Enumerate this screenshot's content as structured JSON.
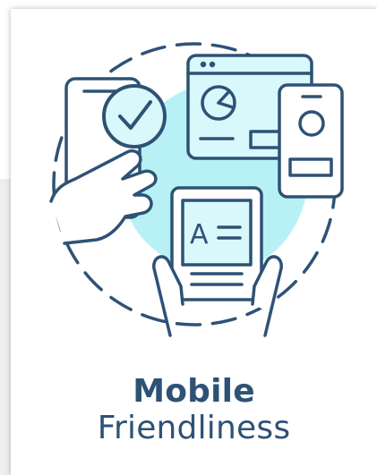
{
  "card": {
    "title": "Mobile",
    "subtitle": "Friendliness"
  },
  "screen_text": "A",
  "icons": {
    "main": "mobile-friendliness-illustration",
    "check": "check-badge-icon",
    "browser": "browser-window-icon",
    "phone_small": "small-phone-icon",
    "tablet": "tablet-reader-icon"
  },
  "colors": {
    "stroke": "#2e5275",
    "accent": "#b7f1f6",
    "accent_light": "#d9f8fb",
    "text": "#2e5275"
  }
}
